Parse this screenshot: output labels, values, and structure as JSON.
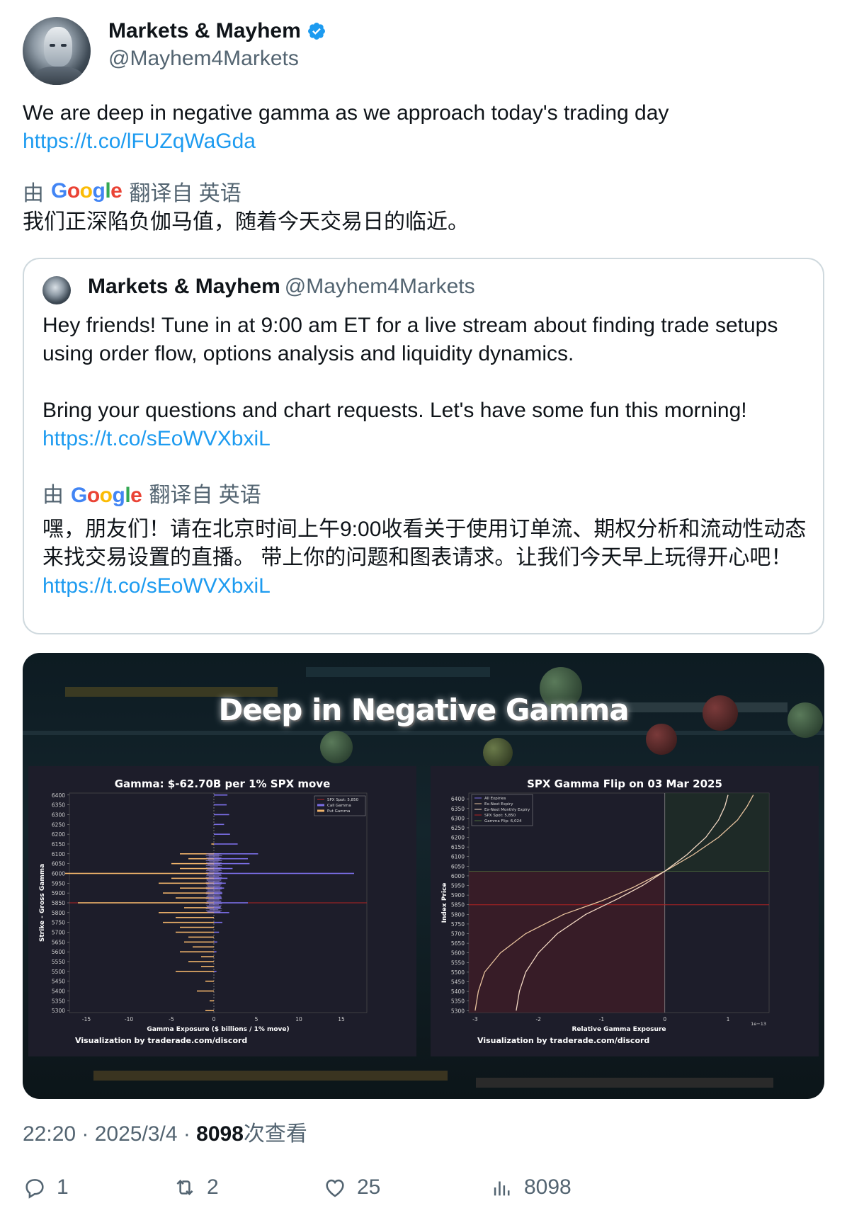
{
  "author": {
    "name": "Markets & Mayhem",
    "handle": "@Mayhem4Markets",
    "verified": true
  },
  "tweet": {
    "text": "We are deep in negative gamma as we approach today's trading day",
    "link": "https://t.co/lFUZqWaGda",
    "translate_prefix": "由",
    "translate_brand": "Google",
    "translate_suffix": "翻译自 英语",
    "translation": "我们正深陷负伽马值，随着今天交易日的临近。"
  },
  "quote": {
    "name": "Markets & Mayhem",
    "handle": "@Mayhem4Markets",
    "text1": "Hey friends! Tune in at 9:00 am ET for a live stream about finding trade setups using order flow, options analysis and liquidity dynamics.",
    "text2": "Bring your questions and chart requests. Let's have some fun this morning!",
    "link": "https://t.co/sEoWVXbxiL",
    "translate_prefix": "由",
    "translate_brand": "Google",
    "translate_suffix": "翻译自 英语",
    "translation": "嘿，朋友们！请在北京时间上午9:00收看关于使用订单流、期权分析和流动性动态来找交易设置的直播。 带上你的问题和图表请求。让我们今天早上玩得开心吧！",
    "translation_link": "https://t.co/sEoWVXbxiL"
  },
  "media": {
    "title": "Deep in Negative Gamma",
    "credit": "Visualization by traderade.com/discord"
  },
  "chart_data": [
    {
      "type": "bar",
      "title": "Gamma: $-62.70B per 1% SPX move",
      "xlabel": "Gamma Exposure ($ billions / 1% move)",
      "ylabel": "Strike - Gross Gamma",
      "xlim": [
        -17,
        18
      ],
      "x_ticks": [
        "-15",
        "-10",
        "-5",
        "0",
        "5",
        "10",
        "15"
      ],
      "y_ticks": [
        "6400",
        "6350",
        "6300",
        "6250",
        "6200",
        "6150",
        "6100",
        "6050",
        "6000",
        "5950",
        "5900",
        "5850",
        "5800",
        "5750",
        "5700",
        "5650",
        "5600",
        "5550",
        "5500",
        "5450",
        "5400",
        "5350",
        "5300"
      ],
      "legend": [
        "SPX Spot: 5,850",
        "Call Gamma",
        "Put Gamma"
      ],
      "legend_position": "top-right",
      "spot": 5850,
      "series": [
        {
          "name": "Call Gamma",
          "color": "#7b6ee6",
          "strikes": [
            6400,
            6350,
            6300,
            6250,
            6200,
            6150,
            6100,
            6075,
            6050,
            6025,
            6000,
            5975,
            5950,
            5925,
            5900,
            5875,
            5850,
            5825,
            5800,
            5750,
            5700,
            5650,
            5600,
            5500
          ],
          "values": [
            1.6,
            1.5,
            1.8,
            1.2,
            1.9,
            2.8,
            5.2,
            4.0,
            4.2,
            2.2,
            16.5,
            1.6,
            1.4,
            1.2,
            1.0,
            0.9,
            4.0,
            0.8,
            1.8,
            1.0,
            0.6,
            0.4,
            0.3,
            0.3
          ]
        },
        {
          "name": "Put Gamma",
          "color": "#f0b36a",
          "strikes": [
            6150,
            6100,
            6075,
            6050,
            6025,
            6000,
            5975,
            5950,
            5925,
            5900,
            5875,
            5850,
            5825,
            5800,
            5775,
            5750,
            5725,
            5700,
            5675,
            5650,
            5625,
            5600,
            5575,
            5550,
            5525,
            5500,
            5450,
            5400,
            5350,
            5300
          ],
          "values": [
            -0.3,
            -4.0,
            -3.0,
            -5.0,
            -4.0,
            -17.5,
            -5.0,
            -6.5,
            -4.0,
            -6.0,
            -4.5,
            -16.0,
            -3.5,
            -6.5,
            -4.5,
            -6.0,
            -4.0,
            -4.5,
            -3.0,
            -3.5,
            -2.5,
            -4.0,
            -1.5,
            -3.0,
            -1.5,
            -4.5,
            -1.0,
            -2.0,
            -0.5,
            -1.0
          ]
        }
      ]
    },
    {
      "type": "line",
      "title": "SPX Gamma Flip on 03 Mar 2025",
      "xlabel": "Relative Gamma Exposure",
      "ylabel": "Index Price",
      "x_ticks": [
        "-3",
        "-2",
        "-1",
        "0",
        "1"
      ],
      "x_scale_label": "1e−13",
      "xlim": [
        -3.1,
        1.65
      ],
      "y_ticks": [
        "6400",
        "6350",
        "6300",
        "6250",
        "6200",
        "6150",
        "6100",
        "6050",
        "6000",
        "5950",
        "5900",
        "5850",
        "5800",
        "5750",
        "5700",
        "5650",
        "5600",
        "5550",
        "5500",
        "5450",
        "5400",
        "5350",
        "5300"
      ],
      "ylim": [
        5290,
        6430
      ],
      "legend": [
        "All Expiries",
        "Ex-Next Expiry",
        "Ex-Next Monthly Expiry",
        "SPX Spot: 5,850",
        "Gamma Flip: 6,024"
      ],
      "legend_position": "top-left",
      "spot": 5850,
      "gamma_flip": 6024,
      "series": [
        {
          "name": "Ex-Next Expiry",
          "color": "#e8c39e",
          "x": [
            -3.0,
            -2.95,
            -2.85,
            -2.6,
            -2.2,
            -1.6,
            -1.0,
            -0.5,
            0.0,
            0.45,
            0.85,
            1.15,
            1.3,
            1.4
          ],
          "y": [
            5300,
            5400,
            5500,
            5600,
            5700,
            5800,
            5870,
            5940,
            6024,
            6110,
            6200,
            6290,
            6360,
            6420
          ]
        },
        {
          "name": "Ex-Next Monthly Expiry",
          "color": "#f3d9c4",
          "x": [
            -2.35,
            -2.3,
            -2.2,
            -2.0,
            -1.7,
            -1.25,
            -0.75,
            -0.35,
            0.0,
            0.35,
            0.65,
            0.85,
            0.95,
            1.0
          ],
          "y": [
            5300,
            5400,
            5500,
            5600,
            5700,
            5800,
            5880,
            5950,
            6024,
            6110,
            6200,
            6290,
            6360,
            6420
          ]
        }
      ]
    }
  ],
  "meta": {
    "time": "22:20 · 2025/3/4 · ",
    "views": "8098",
    "views_suffix": "次查看"
  },
  "actions": {
    "replies": "1",
    "reposts": "2",
    "likes": "25",
    "views": "8098"
  },
  "colors": {
    "link": "#1d9bf0",
    "secondary": "#536471",
    "verified": "#1d9bf0",
    "spot_line": "#b22222"
  }
}
